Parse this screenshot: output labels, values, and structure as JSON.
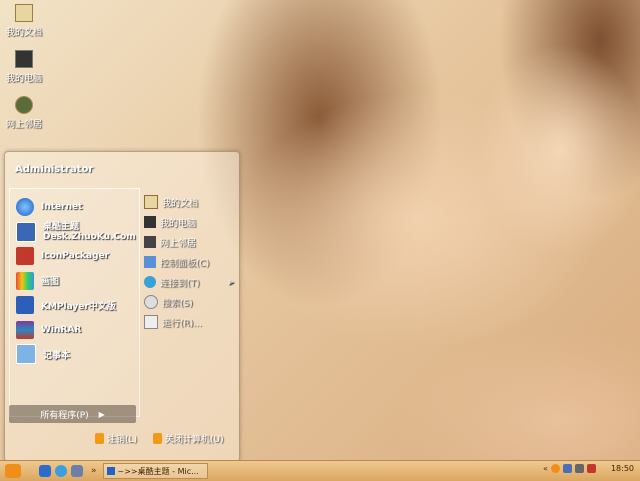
{
  "desktop": {
    "icons": [
      {
        "label": "我的文档",
        "icon": "folder-documents-icon"
      },
      {
        "label": "我的电脑",
        "icon": "computer-icon"
      },
      {
        "label": "网上邻居",
        "icon": "network-places-icon"
      }
    ]
  },
  "start_menu": {
    "user": "Administrator",
    "programs": [
      {
        "label": "Internet",
        "icon": "internet-explorer-icon"
      },
      {
        "label": "桌酷主题",
        "sublabel": "Desk.ZhuoKu.Com",
        "icon": "zhuoku-theme-icon"
      },
      {
        "label": "IconPackager",
        "icon": "iconpackager-icon"
      },
      {
        "label": "画图",
        "icon": "paint-icon"
      },
      {
        "label": "KMPlayer中文版",
        "icon": "kmplayer-icon"
      },
      {
        "label": "WinRAR",
        "icon": "winrar-icon"
      },
      {
        "label": "记事本",
        "icon": "notepad-icon"
      }
    ],
    "all_programs": "所有程序(P)",
    "places": [
      {
        "label": "我的文档",
        "icon": "my-documents-icon"
      },
      {
        "label": "我的电脑",
        "icon": "my-computer-icon"
      },
      {
        "label": "网上邻居",
        "icon": "network-icon"
      },
      {
        "label": "控制面板(C)",
        "icon": "control-panel-icon"
      },
      {
        "label": "连接到(T)",
        "icon": "connect-to-icon"
      },
      {
        "label": "搜索(S)",
        "icon": "search-icon"
      },
      {
        "label": "运行(R)...",
        "icon": "run-icon"
      }
    ],
    "logoff": "注销(L)",
    "shutdown": "关闭计算机(U)"
  },
  "taskbar": {
    "task": "~>>桌酷主题 - Mic...",
    "clock": "18:50"
  },
  "colors": {
    "taskbar": "#dca760",
    "accent": "#f08f18"
  }
}
